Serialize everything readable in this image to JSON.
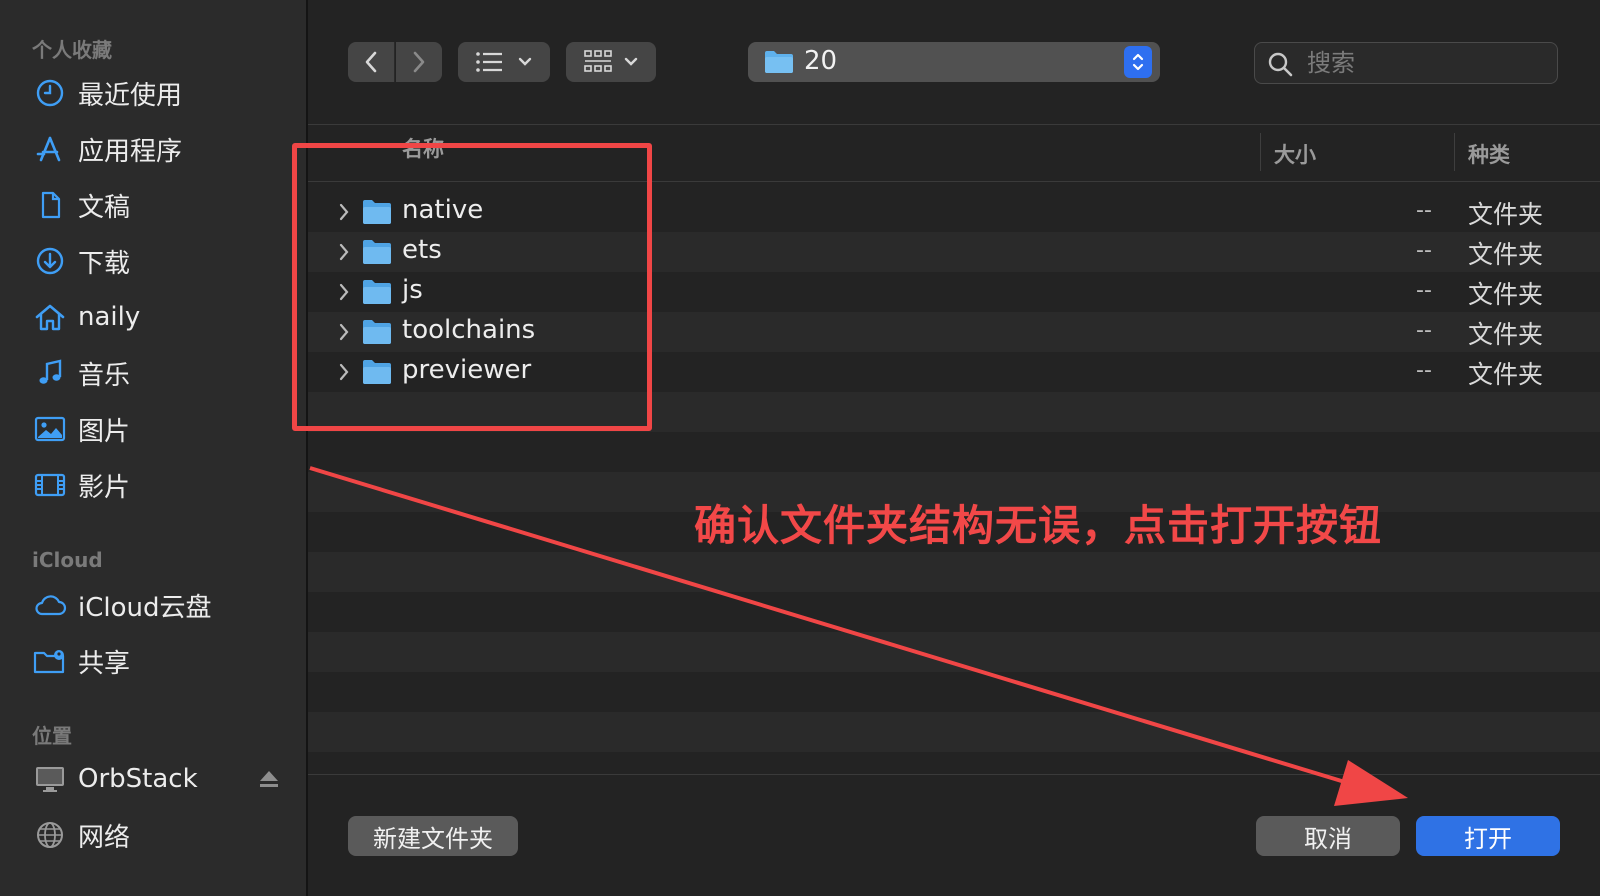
{
  "sidebar": {
    "favorites_title": "个人收藏",
    "favorites": [
      {
        "label": "最近使用",
        "icon": "clock-icon"
      },
      {
        "label": "应用程序",
        "icon": "apps-icon"
      },
      {
        "label": "文稿",
        "icon": "document-icon"
      },
      {
        "label": "下载",
        "icon": "download-icon"
      },
      {
        "label": "naily",
        "icon": "home-icon"
      },
      {
        "label": "音乐",
        "icon": "music-icon"
      },
      {
        "label": "图片",
        "icon": "photo-icon"
      },
      {
        "label": "影片",
        "icon": "film-icon"
      }
    ],
    "icloud_title": "iCloud",
    "icloud": [
      {
        "label": "iCloud云盘",
        "icon": "cloud-icon"
      },
      {
        "label": "共享",
        "icon": "shared-folder-icon"
      }
    ],
    "locations_title": "位置",
    "locations": [
      {
        "label": "OrbStack",
        "icon": "display-icon"
      },
      {
        "label": "网络",
        "icon": "globe-icon"
      }
    ]
  },
  "toolbar": {
    "path_label": "20",
    "search_placeholder": "搜索"
  },
  "columns": {
    "name": "名称",
    "size": "大小",
    "kind": "种类"
  },
  "rows": [
    {
      "name": "native",
      "size": "--",
      "kind": "文件夹"
    },
    {
      "name": "ets",
      "size": "--",
      "kind": "文件夹"
    },
    {
      "name": "js",
      "size": "--",
      "kind": "文件夹"
    },
    {
      "name": "toolchains",
      "size": "--",
      "kind": "文件夹"
    },
    {
      "name": "previewer",
      "size": "--",
      "kind": "文件夹"
    }
  ],
  "footer": {
    "new_folder": "新建文件夹",
    "cancel": "取消",
    "open": "打开"
  },
  "annotation": {
    "text": "确认文件夹结构无误，点击打开按钮",
    "color": "#f04646"
  },
  "colors": {
    "accent": "#2f72e5",
    "folder": "#5fb1ec"
  }
}
